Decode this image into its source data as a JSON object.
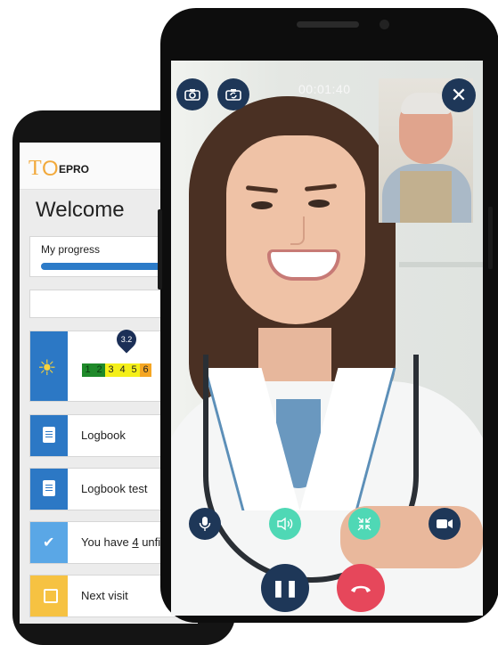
{
  "back_app": {
    "logo_mark_t": "T",
    "logo_mark_o": "O",
    "logo_text": "EPRO",
    "welcome": "Welcome",
    "progress": {
      "label": "My progress",
      "value_fraction": 0.83
    },
    "scale": {
      "marker_value": "3.2",
      "cells": [
        {
          "label": "1",
          "color": "#1f8a2a",
          "text_color": "#0b3b10"
        },
        {
          "label": "2",
          "color": "#1f8a2a",
          "text_color": "#0b3b10"
        },
        {
          "label": "3",
          "color": "#f4ef19",
          "text_color": "#222222"
        },
        {
          "label": "4",
          "color": "#f4ef19",
          "text_color": "#222222"
        },
        {
          "label": "5",
          "color": "#f4ef19",
          "text_color": "#222222"
        },
        {
          "label": "6",
          "color": "#f5a623",
          "text_color": "#222222"
        }
      ],
      "icon": "sun-icon"
    },
    "list_items": [
      {
        "label": "Logbook",
        "icon": "clipboard-icon",
        "accent": "#2c78c5"
      },
      {
        "label": "Logbook test",
        "icon": "clipboard-icon",
        "accent": "#2c78c5"
      },
      {
        "label_prefix": "You have ",
        "label_count": "4",
        "label_suffix": " unfin",
        "icon": "double-check-icon",
        "accent": "#5aa7e6"
      },
      {
        "label": "Next visit",
        "icon": "calendar-icon",
        "accent": "#f6c242"
      }
    ]
  },
  "call": {
    "timer": "00:01:40",
    "top_left_buttons": [
      {
        "icon": "camera-icon"
      },
      {
        "icon": "switch-camera-icon"
      }
    ],
    "close_icon": "close-icon",
    "controls": [
      {
        "icon": "microphone-icon",
        "color": "#1e3758"
      },
      {
        "icon": "speaker-icon",
        "color": "#4fd8b5"
      },
      {
        "icon": "minimize-icon",
        "color": "#4fd8b5"
      },
      {
        "icon": "video-icon",
        "color": "#1e3758"
      }
    ],
    "pause_icon": "pause-icon",
    "hangup_icon": "hangup-icon",
    "hangup_color": "#e6475b",
    "accent_dark": "#1e3758"
  }
}
